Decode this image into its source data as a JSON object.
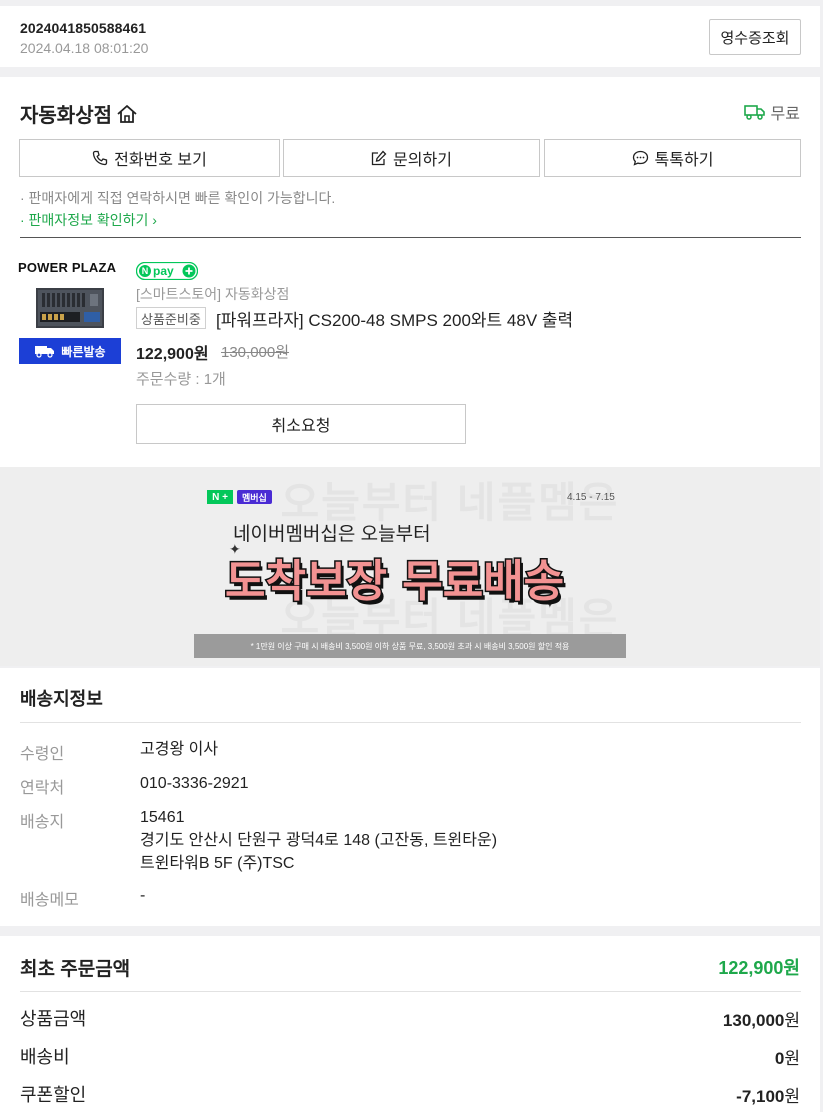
{
  "order": {
    "number": "2024041850588461",
    "datetime": "2024.04.18 08:01:20",
    "receipt_button": "영수증조회"
  },
  "seller": {
    "name": "자동화상점",
    "shipping": "무료",
    "buttons": {
      "phone": "전화번호 보기",
      "inquiry": "문의하기",
      "talk": "톡톡하기"
    },
    "notice": "· 판매자에게 직접 연락하시면 빠른 확인이 가능합니다.",
    "info_link": "· 판매자정보 확인하기 ›"
  },
  "product": {
    "brand": "POWER PLAZA",
    "fast_delivery_badge": "빠른발송",
    "npay_label": "pay",
    "store_path": "[스마트스토어] 자동화상점",
    "status": "상품준비중",
    "name": "[파워프라자] CS200-48 SMPS 200와트 48V 출력",
    "price": "122,900원",
    "original_price": "130,000원",
    "quantity": "주문수량 : 1개",
    "cancel_button": "취소요청"
  },
  "banner": {
    "tag_n": "N +",
    "tag_membership": "멤버십",
    "date_range": "4.15 - 7.15",
    "subtitle": "네이버멤버십은 오늘부터",
    "headline": "도착보장 무료배송",
    "footnote": "* 1만원 이상 구매 시 배송비 3,500원 이하 상품 무료, 3,500원 초과 시 배송비 3,500원 할인 적용",
    "watermark_top": "오늘부터 네플멤은",
    "watermark_bottom": "오늘부터 네플멤은"
  },
  "delivery": {
    "title": "배송지정보",
    "recipient_label": "수령인",
    "recipient": "고경왕 이사",
    "contact_label": "연락처",
    "contact": "010-3336-2921",
    "address_label": "배송지",
    "zipcode": "15461",
    "address_line1": "경기도 안산시 단원구 광덕4로 148 (고잔동, 트윈타운)",
    "address_line2": "트윈타워B 5F (주)TSC",
    "memo_label": "배송메모",
    "memo": "-"
  },
  "amount": {
    "title": "최초 주문금액",
    "total": "122,900원",
    "rows": [
      {
        "label": "상품금액",
        "num": "130,000",
        "unit": "원"
      },
      {
        "label": "배송비",
        "num": "0",
        "unit": "원"
      },
      {
        "label": "쿠폰할인",
        "num": "-7,100",
        "unit": "원"
      }
    ]
  },
  "colors": {
    "accent_green": "#1ea84b",
    "naver_green": "#03c75a",
    "fast_badge_blue": "#1c3fd6",
    "banner_pink": "#f29292"
  },
  "icons": [
    "home-icon",
    "truck-icon",
    "phone-icon",
    "edit-icon",
    "chat-icon",
    "npay-logo",
    "delivery-truck-icon"
  ]
}
